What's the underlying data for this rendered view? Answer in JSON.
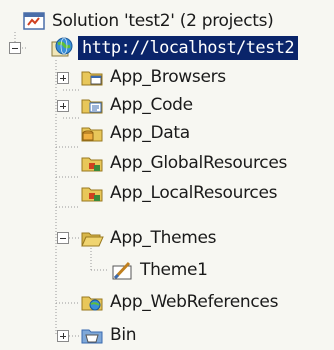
{
  "solution": {
    "label": "Solution 'test2' (2 projects)",
    "icon": "solution-icon"
  },
  "project": {
    "label": "http://localhost/test2",
    "icon": "web-globe-icon",
    "selected": true,
    "expanded": true
  },
  "items": [
    {
      "label": "App_Browsers",
      "icon": "folder-icon",
      "expander": "+"
    },
    {
      "label": "App_Code",
      "icon": "code-folder-icon",
      "expander": "+"
    },
    {
      "label": "App_Data",
      "icon": "data-folder-icon",
      "expander": ""
    },
    {
      "label": "App_GlobalResources",
      "icon": "resources-folder-icon",
      "expander": ""
    },
    {
      "label": "App_LocalResources",
      "icon": "resources-folder-icon",
      "expander": ""
    },
    {
      "label": "App_Themes",
      "icon": "open-folder-icon",
      "expander": "-"
    },
    {
      "label": "App_WebReferences",
      "icon": "web-references-folder-icon",
      "expander": ""
    },
    {
      "label": "Bin",
      "icon": "bin-folder-icon",
      "expander": "+"
    }
  ],
  "theme": {
    "label": "Theme1",
    "icon": "theme-icon"
  },
  "colors": {
    "selection": "#0a246a",
    "folder": "#e8c75a"
  }
}
